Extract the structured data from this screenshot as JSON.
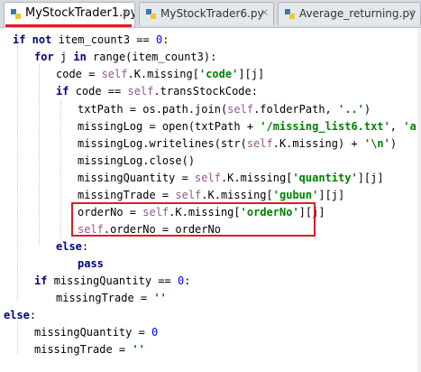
{
  "tabs": [
    {
      "label": "MyStockTrader1.py",
      "close": "×",
      "active": true
    },
    {
      "label": "MyStockTrader6.py",
      "close": "×",
      "active": false
    },
    {
      "label": "Average_returning.py",
      "close": "×",
      "active": false
    }
  ],
  "code_lines": [
    [
      {
        "t": "kw",
        "v": "if not "
      },
      {
        "t": "p",
        "v": "item_count3 == "
      },
      {
        "t": "num",
        "v": "0"
      },
      {
        "t": "p",
        "v": ":"
      }
    ],
    [
      {
        "t": "kw",
        "v": "for "
      },
      {
        "t": "p",
        "v": "j "
      },
      {
        "t": "kw",
        "v": "in "
      },
      {
        "t": "p",
        "v": "range(item_count3):"
      }
    ],
    [
      {
        "t": "p",
        "v": "code = "
      },
      {
        "t": "slf",
        "v": "self"
      },
      {
        "t": "p",
        "v": ".K.missing["
      },
      {
        "t": "str",
        "v": "'code'"
      },
      {
        "t": "p",
        "v": "][j]"
      }
    ],
    [
      {
        "t": "kw",
        "v": "if "
      },
      {
        "t": "p",
        "v": "code == "
      },
      {
        "t": "slf",
        "v": "self"
      },
      {
        "t": "p",
        "v": ".transStockCode:"
      }
    ],
    [
      {
        "t": "p",
        "v": "txtPath = os.path.join("
      },
      {
        "t": "slf",
        "v": "self"
      },
      {
        "t": "p",
        "v": ".folderPath, "
      },
      {
        "t": "str",
        "v": "'..'"
      },
      {
        "t": "p",
        "v": ")"
      }
    ],
    [
      {
        "t": "p",
        "v": "missingLog = open(txtPath + "
      },
      {
        "t": "str",
        "v": "'/missing_list6.txt'"
      },
      {
        "t": "p",
        "v": ", "
      },
      {
        "t": "str",
        "v": "'a'"
      },
      {
        "t": "p",
        "v": ")"
      }
    ],
    [
      {
        "t": "p",
        "v": "missingLog.writelines(str("
      },
      {
        "t": "slf",
        "v": "self"
      },
      {
        "t": "p",
        "v": ".K.missing) + "
      },
      {
        "t": "str",
        "v": "'\\n'"
      },
      {
        "t": "p",
        "v": ")"
      }
    ],
    [
      {
        "t": "p",
        "v": "missingLog.close()"
      }
    ],
    [
      {
        "t": "p",
        "v": "missingQuantity = "
      },
      {
        "t": "slf",
        "v": "self"
      },
      {
        "t": "p",
        "v": ".K.missing["
      },
      {
        "t": "str",
        "v": "'quantity'"
      },
      {
        "t": "p",
        "v": "][j]"
      }
    ],
    [
      {
        "t": "p",
        "v": "missingTrade = "
      },
      {
        "t": "slf",
        "v": "self"
      },
      {
        "t": "p",
        "v": ".K.missing["
      },
      {
        "t": "str",
        "v": "'gubun'"
      },
      {
        "t": "p",
        "v": "][j]"
      }
    ],
    [
      {
        "t": "p",
        "v": "orderNo = "
      },
      {
        "t": "slf",
        "v": "self"
      },
      {
        "t": "p",
        "v": ".K.missing["
      },
      {
        "t": "str",
        "v": "'orderNo'"
      },
      {
        "t": "p",
        "v": "][j]"
      }
    ],
    [
      {
        "t": "slf",
        "v": "self"
      },
      {
        "t": "p",
        "v": ".orderNo = orderNo"
      }
    ],
    [
      {
        "t": "kw",
        "v": "else"
      },
      {
        "t": "p",
        "v": ":"
      }
    ],
    [
      {
        "t": "kw",
        "v": "pass"
      }
    ],
    [
      {
        "t": "kw",
        "v": "if "
      },
      {
        "t": "p",
        "v": "missingQuantity == "
      },
      {
        "t": "num",
        "v": "0"
      },
      {
        "t": "p",
        "v": ":"
      }
    ],
    [
      {
        "t": "p",
        "v": "missingTrade = "
      },
      {
        "t": "str",
        "v": "''"
      }
    ],
    [
      {
        "t": "kw",
        "v": "else"
      },
      {
        "t": "p",
        "v": ":"
      }
    ],
    [
      {
        "t": "p",
        "v": "missingQuantity = "
      },
      {
        "t": "num",
        "v": "0"
      }
    ],
    [
      {
        "t": "p",
        "v": "missingTrade = "
      },
      {
        "t": "str",
        "v": "''"
      }
    ]
  ],
  "colors": {
    "keyword": "#000080",
    "self": "#94558d",
    "string": "#008000",
    "number": "#0000ff",
    "highlight_box": "#e01b24"
  }
}
